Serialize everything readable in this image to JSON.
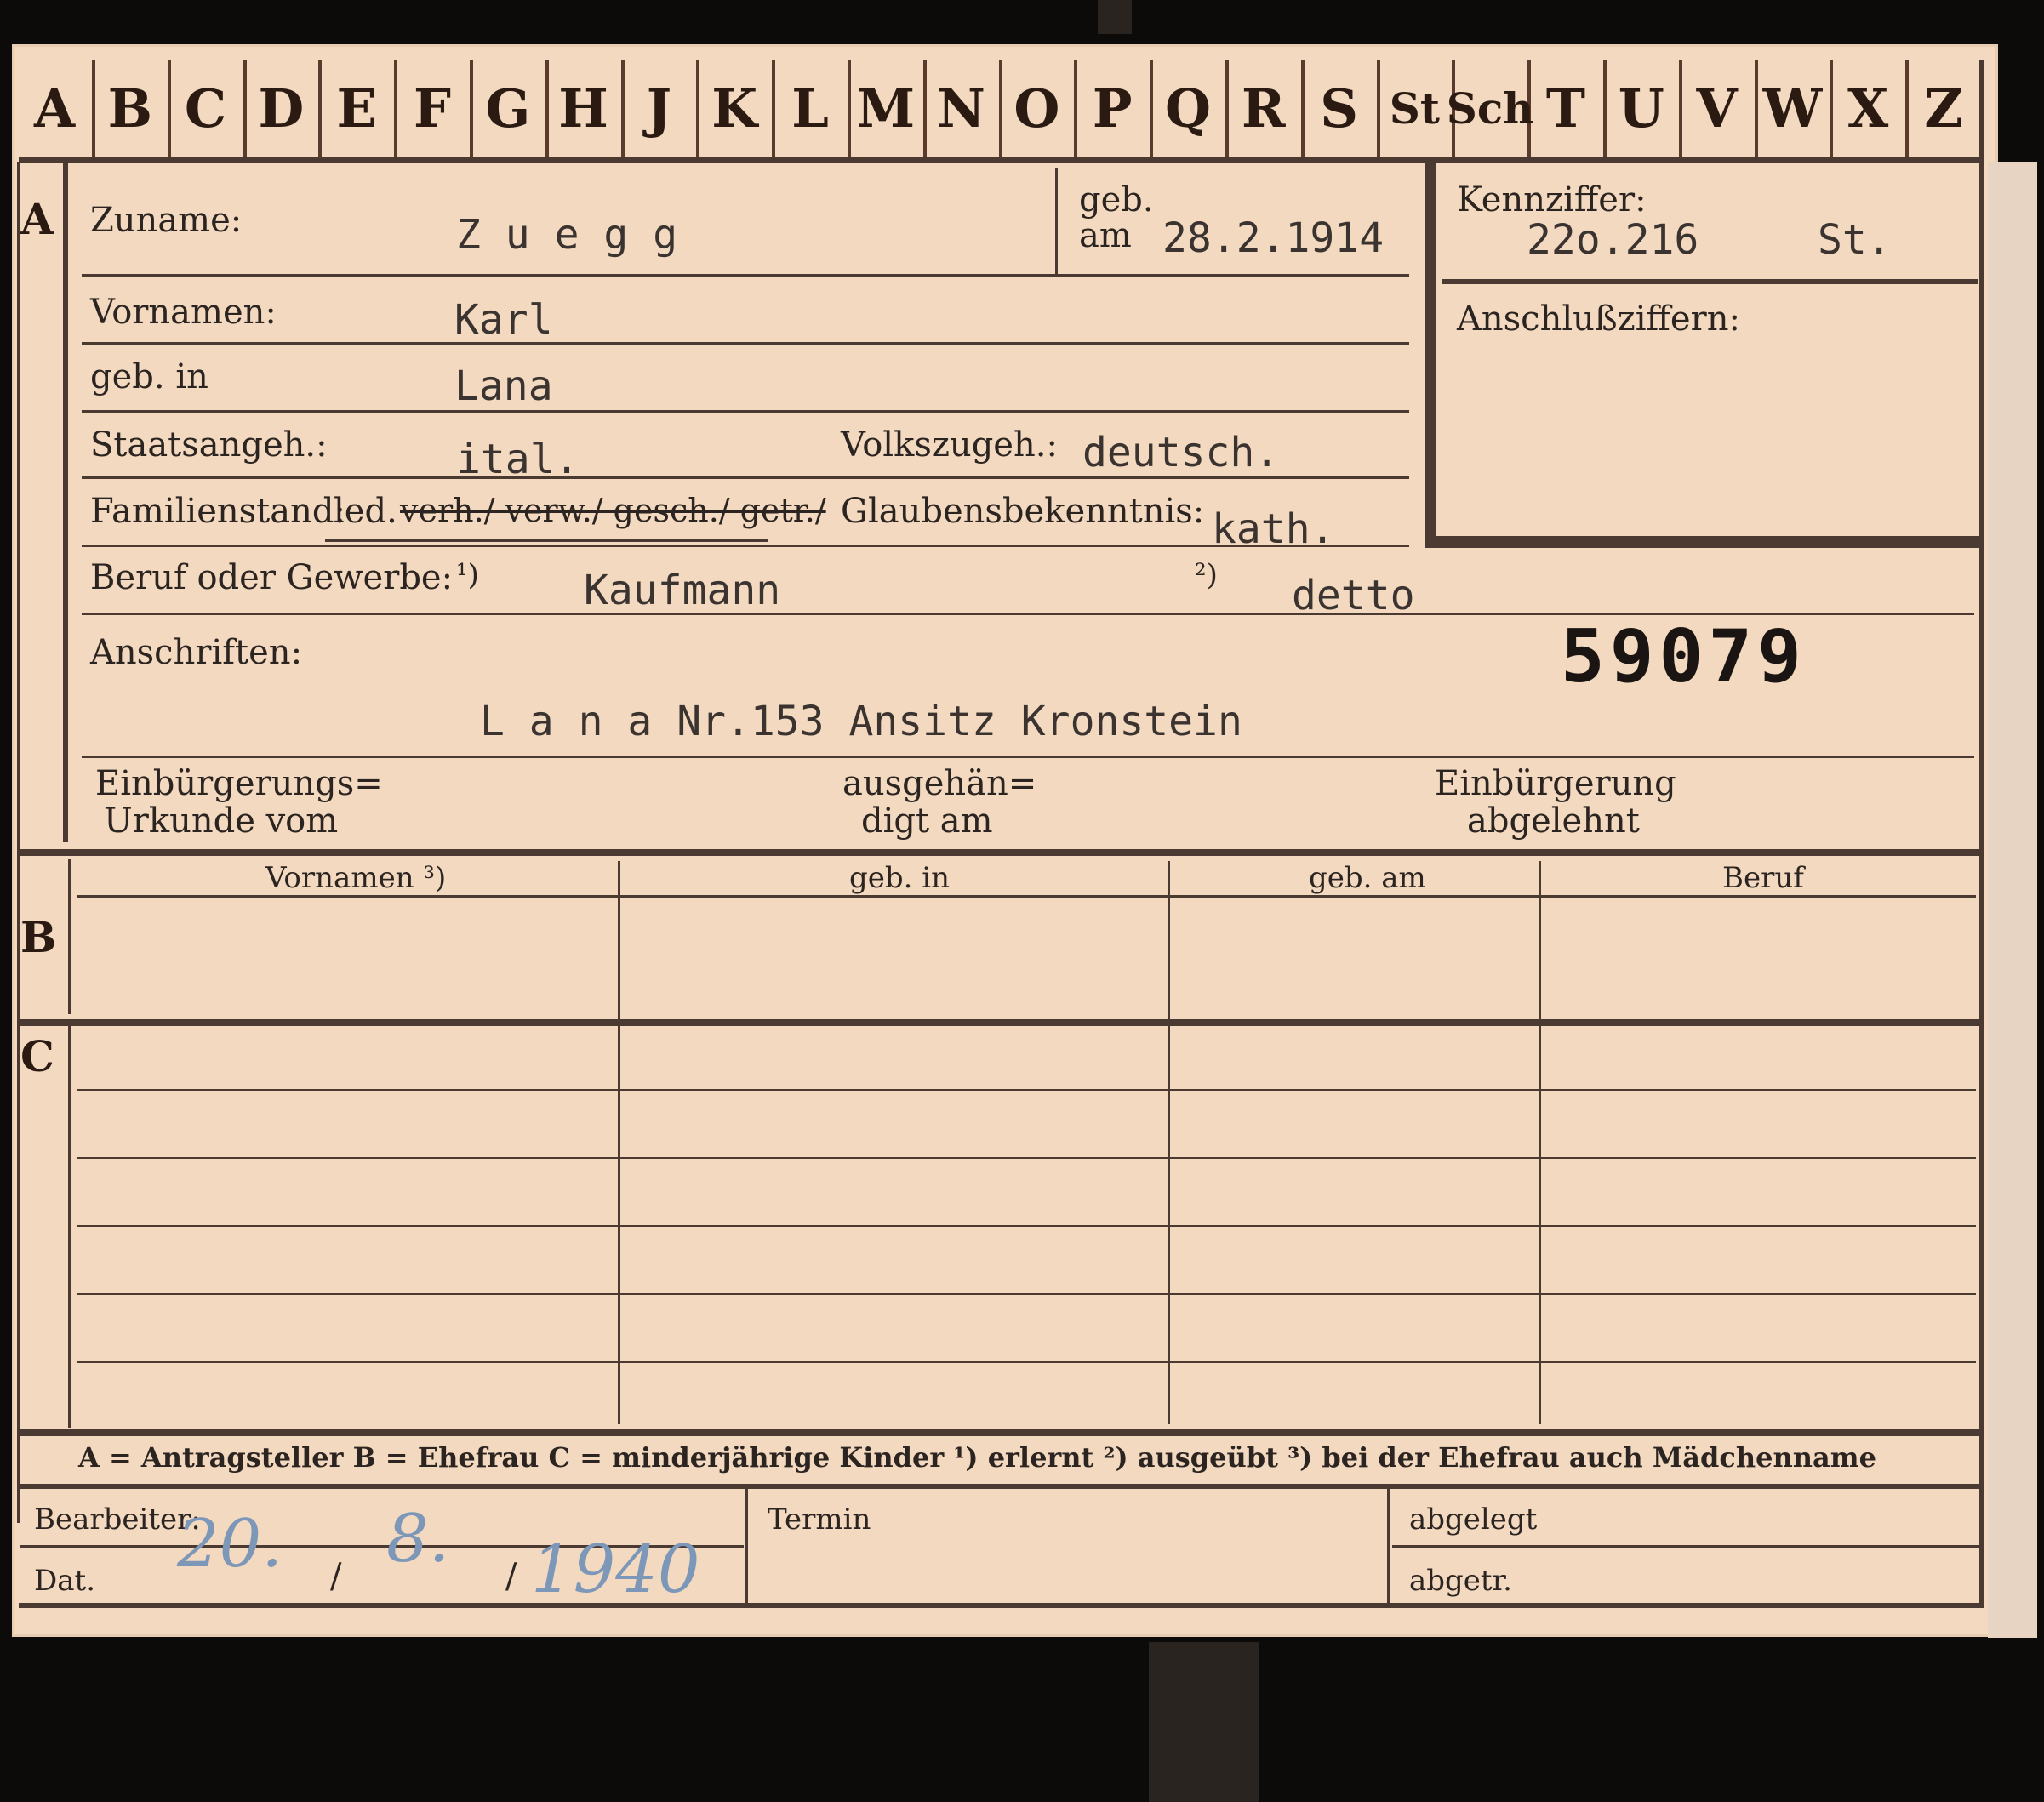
{
  "letter_tabs": [
    "A",
    "B",
    "C",
    "D",
    "E",
    "F",
    "G",
    "H",
    "J",
    "K",
    "L",
    "M",
    "N",
    "O",
    "P",
    "Q",
    "R",
    "S",
    "St",
    "Sch",
    "T",
    "U",
    "V",
    "W",
    "X",
    "Z"
  ],
  "section_letters": {
    "a": "A",
    "b": "B",
    "c": "C"
  },
  "header": {
    "zuname_label": "Zuname:",
    "zuname_value": "Z u e g g",
    "geb_am_label_1": "geb.",
    "geb_am_label_2": "am",
    "geb_am_value": "28.2.1914",
    "kennziffer_label": "Kennziffer:",
    "kennziffer_value": "22o.216",
    "kennziffer_suffix": "St.",
    "anschluss_label": "Anschlußziffern:"
  },
  "fields": {
    "vornamen_label": "Vornamen:",
    "vornamen_value": "Karl",
    "geb_in_label": "geb. in",
    "geb_in_value": "Lana",
    "staatsangeh_label": "Staatsangeh.:",
    "staatsangeh_value": "ital.",
    "volkszugeh_label": "Volkszugeh.:",
    "volkszugeh_value": "deutsch.",
    "familienstand_label": "Familienstand:",
    "familienstand_led": "led.",
    "familienstand_struck": "verh./ verw./ gesch./ getr./",
    "glaubens_label": "Glaubensbekenntnis:",
    "glaubens_value": "kath.",
    "beruf_label": "Beruf oder Gewerbe:",
    "beruf_mark_1": "¹)",
    "beruf_value_1": "Kaufmann",
    "beruf_mark_2": "²)",
    "beruf_value_2": "detto",
    "anschriften_label": "Anschriften:",
    "file_number": "59079",
    "anschrift_value": "L a n a Nr.153 Ansitz Kronstein",
    "einbuergerung_1a": "Einbürgerungs=",
    "einbuergerung_1b": "Urkunde vom",
    "einbuergerung_2a": "ausgehän=",
    "einbuergerung_2b": "digt am",
    "einbuergerung_3a": "Einbürgerung",
    "einbuergerung_3b": "abgelehnt"
  },
  "table_b": {
    "columns": [
      "Vornamen ³)",
      "geb. in",
      "geb. am",
      "Beruf"
    ]
  },
  "legend": "A = Antragsteller   B = Ehefrau   C = minderjährige Kinder   ¹) erlernt   ²) ausgeübt   ³) bei der Ehefrau auch Mädchenname",
  "footer": {
    "bearbeiter_label": "Bearbeiter:",
    "dat_label": "Dat.",
    "date_day": "20.",
    "date_month": "8.",
    "date_year": "1940",
    "date_sep": "/",
    "termin_label": "Termin",
    "abgelegt_label": "abgelegt",
    "abgetr_label": "abgetr."
  },
  "colors": {
    "card": "#f2d9c0",
    "ink": "#2c2420",
    "rule": "#4a3a32",
    "handwriting": "#7d97b8"
  }
}
